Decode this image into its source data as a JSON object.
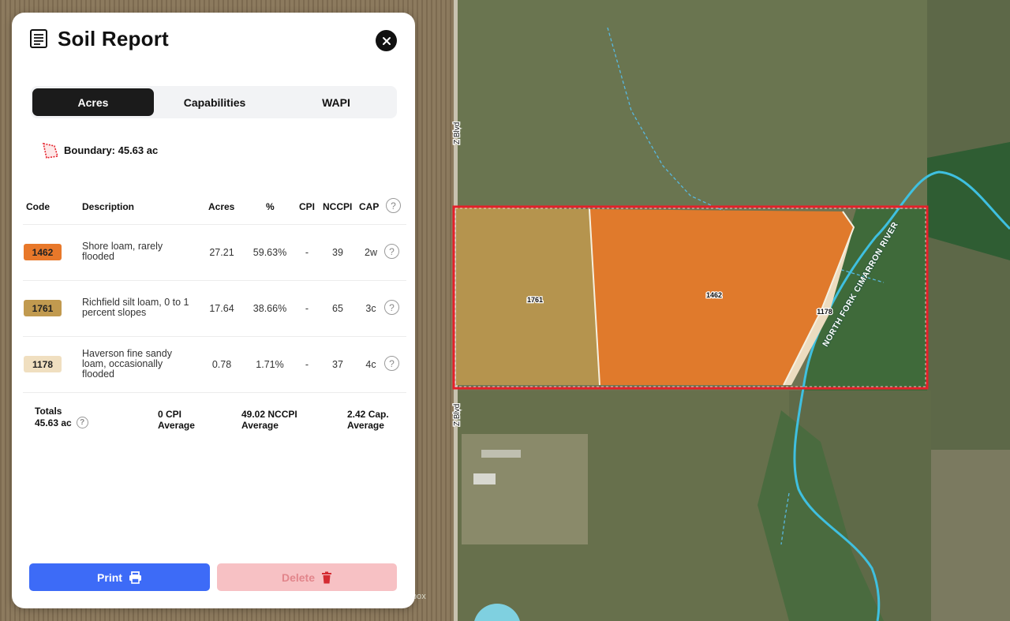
{
  "header": {
    "title": "Soil Report"
  },
  "tabs": [
    {
      "label": "Acres",
      "active": true
    },
    {
      "label": "Capabilities",
      "active": false
    },
    {
      "label": "WAPI",
      "active": false
    }
  ],
  "boundary": {
    "label": "Boundary: 45.63 ac"
  },
  "table": {
    "headers": {
      "code": "Code",
      "description": "Description",
      "acres": "Acres",
      "percent": "%",
      "cpi": "CPI",
      "nccpi": "NCCPI",
      "cap": "CAP"
    },
    "rows": [
      {
        "code": "1462",
        "color": "#e8782a",
        "description": "Shore loam, rarely flooded",
        "acres": "27.21",
        "percent": "59.63%",
        "cpi": "-",
        "nccpi": "39",
        "cap": "2w"
      },
      {
        "code": "1761",
        "color": "#c19a4f",
        "description": "Richfield silt loam, 0 to 1 percent slopes",
        "acres": "17.64",
        "percent": "38.66%",
        "cpi": "-",
        "nccpi": "65",
        "cap": "3c"
      },
      {
        "code": "1178",
        "color": "#f0dfc0",
        "description": "Haverson fine sandy loam, occasionally flooded",
        "acres": "0.78",
        "percent": "1.71%",
        "cpi": "-",
        "nccpi": "37",
        "cap": "4c"
      }
    ],
    "totals": {
      "label": "Totals",
      "acres": "45.63 ac",
      "cpi_value": "0 CPI",
      "cpi_label": "Average",
      "nccpi_value": "49.02 NCCPI",
      "nccpi_label": "Average",
      "cap_value": "2.42 Cap.",
      "cap_label": "Average"
    }
  },
  "buttons": {
    "print": "Print",
    "delete": "Delete"
  },
  "map": {
    "polygon_labels": [
      "1761",
      "1462",
      "1178"
    ],
    "road_labels": [
      "Z Blvd",
      "Z Blvd"
    ],
    "river_label": "NORTH FORK CIMARRON RIVER",
    "attribution": "box"
  },
  "icons": {
    "title": "report-icon",
    "close": "close-icon",
    "boundary": "polygon-boundary-icon",
    "help": "help-icon",
    "print": "printer-icon",
    "delete": "trash-icon"
  },
  "colors": {
    "primary": "#3d6bf7",
    "danger_bg": "#f7c1c4",
    "danger_icon": "#d42b32",
    "boundary": "#e5202a",
    "river": "#3fc0e0"
  }
}
